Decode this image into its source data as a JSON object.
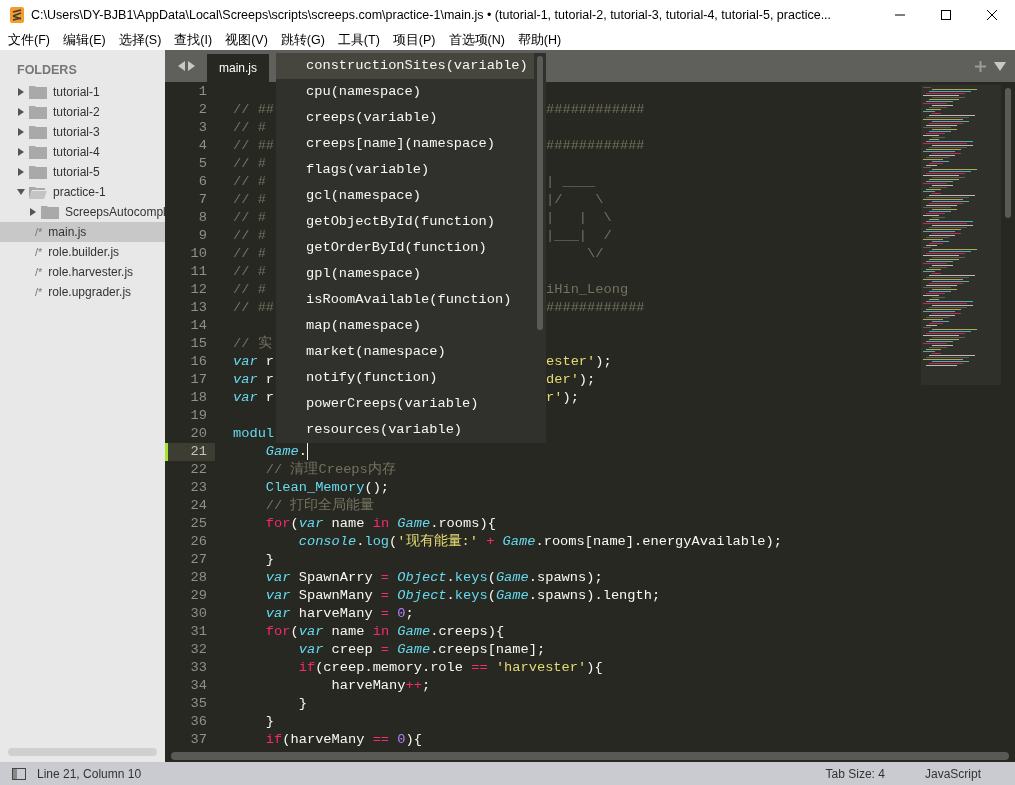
{
  "window": {
    "title": "C:\\Users\\DY-BJB1\\AppData\\Local\\Screeps\\scripts\\screeps.com\\practice-1\\main.js • (tutorial-1, tutorial-2, tutorial-3, tutorial-4, tutorial-5, practice..."
  },
  "menu": [
    "文件(F)",
    "编辑(E)",
    "选择(S)",
    "查找(I)",
    "视图(V)",
    "跳转(G)",
    "工具(T)",
    "项目(P)",
    "首选项(N)",
    "帮助(H)"
  ],
  "sidebar": {
    "header": "FOLDERS",
    "items": [
      {
        "label": "tutorial-1",
        "kind": "folder",
        "expanded": false,
        "selected": false
      },
      {
        "label": "tutorial-2",
        "kind": "folder",
        "expanded": false,
        "selected": false
      },
      {
        "label": "tutorial-3",
        "kind": "folder",
        "expanded": false,
        "selected": false
      },
      {
        "label": "tutorial-4",
        "kind": "folder",
        "expanded": false,
        "selected": false
      },
      {
        "label": "tutorial-5",
        "kind": "folder",
        "expanded": false,
        "selected": false
      },
      {
        "label": "practice-1",
        "kind": "folder",
        "expanded": true,
        "selected": false,
        "children": [
          {
            "label": "ScreepsAutocompl",
            "kind": "folder",
            "expanded": false,
            "selected": false
          },
          {
            "label": "main.js",
            "kind": "file",
            "icon": "/*",
            "selected": true
          },
          {
            "label": "role.builder.js",
            "kind": "file",
            "icon": "/*",
            "selected": false
          },
          {
            "label": "role.harvester.js",
            "kind": "file",
            "icon": "/*",
            "selected": false
          },
          {
            "label": "role.upgrader.js",
            "kind": "file",
            "icon": "/*",
            "selected": false
          }
        ]
      }
    ]
  },
  "tabs": [
    {
      "label": "main.js",
      "selected": true
    }
  ],
  "editor": {
    "lines": [
      {
        "number": "1",
        "current": false
      },
      {
        "number": "2",
        "current": false,
        "tokens": [
          {
            "t": "// ##",
            "kind": "comment"
          }
        ],
        "right": [
          {
            "t": "############",
            "kind": "comment"
          }
        ]
      },
      {
        "number": "3",
        "current": false,
        "tokens": [
          {
            "t": "// #",
            "kind": "comment"
          }
        ]
      },
      {
        "number": "4",
        "current": false,
        "tokens": [
          {
            "t": "// ##",
            "kind": "comment"
          }
        ],
        "right": [
          {
            "t": "############",
            "kind": "comment"
          }
        ]
      },
      {
        "number": "5",
        "current": false,
        "tokens": [
          {
            "t": "// #",
            "kind": "comment"
          }
        ]
      },
      {
        "number": "6",
        "current": false,
        "tokens": [
          {
            "t": "// #",
            "kind": "comment"
          }
        ],
        "right": [
          {
            "t": "| ____",
            "kind": "comment"
          }
        ]
      },
      {
        "number": "7",
        "current": false,
        "tokens": [
          {
            "t": "// #",
            "kind": "comment"
          }
        ],
        "right": [
          {
            "t": "|/    \\",
            "kind": "comment"
          }
        ]
      },
      {
        "number": "8",
        "current": false,
        "tokens": [
          {
            "t": "// #",
            "kind": "comment"
          }
        ],
        "right": [
          {
            "t": "|   |  \\",
            "kind": "comment"
          }
        ]
      },
      {
        "number": "9",
        "current": false,
        "tokens": [
          {
            "t": "// #",
            "kind": "comment"
          }
        ],
        "right": [
          {
            "t": "|___|  /",
            "kind": "comment"
          }
        ]
      },
      {
        "number": "10",
        "current": false,
        "tokens": [
          {
            "t": "// #",
            "kind": "comment"
          }
        ],
        "right": [
          {
            "t": "     \\/",
            "kind": "comment"
          }
        ]
      },
      {
        "number": "11",
        "current": false,
        "tokens": [
          {
            "t": "// #",
            "kind": "comment"
          }
        ]
      },
      {
        "number": "12",
        "current": false,
        "tokens": [
          {
            "t": "// #",
            "kind": "comment"
          }
        ],
        "right": [
          {
            "t": "iHin_Leong",
            "kind": "comment"
          }
        ]
      },
      {
        "number": "13",
        "current": false,
        "tokens": [
          {
            "t": "// ##",
            "kind": "comment"
          }
        ],
        "right": [
          {
            "t": "############",
            "kind": "comment"
          }
        ]
      },
      {
        "number": "14",
        "current": false
      },
      {
        "number": "15",
        "current": false,
        "tokens": [
          {
            "t": "// 实",
            "kind": "comment"
          }
        ]
      },
      {
        "number": "16",
        "current": false,
        "tokens": [
          {
            "t": "var",
            "kind": "storage"
          },
          {
            "t": " r",
            "kind": "plain"
          }
        ],
        "right": [
          {
            "t": "ester'",
            "kind": "string"
          },
          {
            "t": ");",
            "kind": "plain"
          }
        ]
      },
      {
        "number": "17",
        "current": false,
        "tokens": [
          {
            "t": "var",
            "kind": "storage"
          },
          {
            "t": " r",
            "kind": "plain"
          }
        ],
        "right": [
          {
            "t": "der'",
            "kind": "string"
          },
          {
            "t": ");",
            "kind": "plain"
          }
        ]
      },
      {
        "number": "18",
        "current": false,
        "tokens": [
          {
            "t": "var",
            "kind": "storage"
          },
          {
            "t": " r",
            "kind": "plain"
          }
        ],
        "right": [
          {
            "t": "r'",
            "kind": "string"
          },
          {
            "t": ");",
            "kind": "plain"
          }
        ]
      },
      {
        "number": "19",
        "current": false
      },
      {
        "number": "20",
        "current": false,
        "tokens": [
          {
            "t": "modul",
            "kind": "func"
          }
        ]
      },
      {
        "number": "21",
        "current": true,
        "tokens": [
          {
            "t": "    Game",
            "kind": "support"
          },
          {
            "t": ".",
            "kind": "plain"
          }
        ]
      },
      {
        "number": "22",
        "current": false,
        "tokens": [
          {
            "t": "    // 清理Creeps内存",
            "kind": "comment"
          }
        ]
      },
      {
        "number": "23",
        "current": false,
        "tokens": [
          {
            "t": "    Clean_Memory",
            "kind": "func"
          },
          {
            "t": "();",
            "kind": "plain"
          }
        ]
      },
      {
        "number": "24",
        "current": false,
        "tokens": [
          {
            "t": "    // 打印全局能量",
            "kind": "comment"
          }
        ]
      },
      {
        "number": "25",
        "current": false,
        "tokens": [
          {
            "t": "    for",
            "kind": "keyword"
          },
          {
            "t": "(",
            "kind": "plain"
          },
          {
            "t": "var",
            "kind": "storage"
          },
          {
            "t": " name ",
            "kind": "plain"
          },
          {
            "t": "in ",
            "kind": "keyword"
          },
          {
            "t": "Game",
            "kind": "support"
          },
          {
            "t": ".rooms){",
            "kind": "plain"
          }
        ]
      },
      {
        "number": "26",
        "current": false,
        "tokens": [
          {
            "t": "        console",
            "kind": "support"
          },
          {
            "t": ".",
            "kind": "plain"
          },
          {
            "t": "log",
            "kind": "func"
          },
          {
            "t": "(",
            "kind": "plain"
          },
          {
            "t": "'现有能量:' ",
            "kind": "string"
          },
          {
            "t": "+ ",
            "kind": "operator"
          },
          {
            "t": "Game",
            "kind": "support"
          },
          {
            "t": ".rooms[name].energyAvailable);",
            "kind": "plain"
          }
        ]
      },
      {
        "number": "27",
        "current": false,
        "tokens": [
          {
            "t": "    }",
            "kind": "plain"
          }
        ]
      },
      {
        "number": "28",
        "current": false,
        "tokens": [
          {
            "t": "    var",
            "kind": "storage"
          },
          {
            "t": " SpawnArry ",
            "kind": "plain"
          },
          {
            "t": "= ",
            "kind": "operator"
          },
          {
            "t": "Object",
            "kind": "support"
          },
          {
            "t": ".",
            "kind": "plain"
          },
          {
            "t": "keys",
            "kind": "func"
          },
          {
            "t": "(",
            "kind": "plain"
          },
          {
            "t": "Game",
            "kind": "support"
          },
          {
            "t": ".spawns);",
            "kind": "plain"
          }
        ]
      },
      {
        "number": "29",
        "current": false,
        "tokens": [
          {
            "t": "    var",
            "kind": "storage"
          },
          {
            "t": " SpawnMany ",
            "kind": "plain"
          },
          {
            "t": "= ",
            "kind": "operator"
          },
          {
            "t": "Object",
            "kind": "support"
          },
          {
            "t": ".",
            "kind": "plain"
          },
          {
            "t": "keys",
            "kind": "func"
          },
          {
            "t": "(",
            "kind": "plain"
          },
          {
            "t": "Game",
            "kind": "support"
          },
          {
            "t": ".spawns).length;",
            "kind": "plain"
          }
        ]
      },
      {
        "number": "30",
        "current": false,
        "tokens": [
          {
            "t": "    var",
            "kind": "storage"
          },
          {
            "t": " harveMany ",
            "kind": "plain"
          },
          {
            "t": "= ",
            "kind": "operator"
          },
          {
            "t": "0",
            "kind": "number"
          },
          {
            "t": ";",
            "kind": "plain"
          }
        ]
      },
      {
        "number": "31",
        "current": false,
        "tokens": [
          {
            "t": "    for",
            "kind": "keyword"
          },
          {
            "t": "(",
            "kind": "plain"
          },
          {
            "t": "var",
            "kind": "storage"
          },
          {
            "t": " name ",
            "kind": "plain"
          },
          {
            "t": "in ",
            "kind": "keyword"
          },
          {
            "t": "Game",
            "kind": "support"
          },
          {
            "t": ".creeps){",
            "kind": "plain"
          }
        ]
      },
      {
        "number": "32",
        "current": false,
        "tokens": [
          {
            "t": "        var",
            "kind": "storage"
          },
          {
            "t": " creep ",
            "kind": "plain"
          },
          {
            "t": "= ",
            "kind": "operator"
          },
          {
            "t": "Game",
            "kind": "support"
          },
          {
            "t": ".creeps[name];",
            "kind": "plain"
          }
        ]
      },
      {
        "number": "33",
        "current": false,
        "tokens": [
          {
            "t": "        if",
            "kind": "keyword"
          },
          {
            "t": "(creep.memory.role ",
            "kind": "plain"
          },
          {
            "t": "== ",
            "kind": "operator"
          },
          {
            "t": "'harvester'",
            "kind": "string"
          },
          {
            "t": "){",
            "kind": "plain"
          }
        ]
      },
      {
        "number": "34",
        "current": false,
        "tokens": [
          {
            "t": "            harveMany",
            "kind": "plain"
          },
          {
            "t": "++",
            "kind": "operator"
          },
          {
            "t": ";",
            "kind": "plain"
          }
        ]
      },
      {
        "number": "35",
        "current": false,
        "tokens": [
          {
            "t": "        }",
            "kind": "plain"
          }
        ]
      },
      {
        "number": "36",
        "current": false,
        "tokens": [
          {
            "t": "    }",
            "kind": "plain"
          }
        ]
      },
      {
        "number": "37",
        "current": false,
        "tokens": [
          {
            "t": "    if",
            "kind": "keyword"
          },
          {
            "t": "(harveMany ",
            "kind": "plain"
          },
          {
            "t": "== ",
            "kind": "operator"
          },
          {
            "t": "0",
            "kind": "number"
          },
          {
            "t": "){",
            "kind": "plain"
          }
        ]
      }
    ]
  },
  "autocomplete": {
    "items": [
      {
        "label": "constructionSites(variable)",
        "selected": true
      },
      {
        "label": "cpu(namespace)",
        "selected": false
      },
      {
        "label": "creeps(variable)",
        "selected": false
      },
      {
        "label": "creeps[name](namespace)",
        "selected": false
      },
      {
        "label": "flags(variable)",
        "selected": false
      },
      {
        "label": "gcl(namespace)",
        "selected": false
      },
      {
        "label": "getObjectById(function)",
        "selected": false
      },
      {
        "label": "getOrderById(function)",
        "selected": false
      },
      {
        "label": "gpl(namespace)",
        "selected": false
      },
      {
        "label": "isRoomAvailable(function)",
        "selected": false
      },
      {
        "label": "map(namespace)",
        "selected": false
      },
      {
        "label": "market(namespace)",
        "selected": false
      },
      {
        "label": "notify(function)",
        "selected": false
      },
      {
        "label": "powerCreeps(variable)",
        "selected": false
      },
      {
        "label": "resources(variable)",
        "selected": false
      }
    ]
  },
  "status_bar": {
    "position": "Line 21, Column 10",
    "tab_size": "Tab Size: 4",
    "syntax": "JavaScript"
  }
}
